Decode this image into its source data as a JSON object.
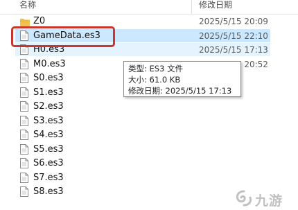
{
  "columns": {
    "name": "名称",
    "date": "修改日期"
  },
  "files": [
    {
      "name": "Z0",
      "date": "2025/5/15 20:09",
      "type": "folder",
      "state": ""
    },
    {
      "name": "GameData.es3",
      "date": "2025/5/15 22:10",
      "type": "file",
      "state": "selected"
    },
    {
      "name": "H0.es3",
      "date": "2025/5/15 17:13",
      "type": "file",
      "state": "hovered"
    },
    {
      "name": "M0.es3",
      "date": "2025/5/15 20:52",
      "type": "file",
      "state": ""
    },
    {
      "name": "S0.es3",
      "date": "",
      "type": "file",
      "state": ""
    },
    {
      "name": "S1.es3",
      "date": "",
      "type": "file",
      "state": ""
    },
    {
      "name": "S2.es3",
      "date": "",
      "type": "file",
      "state": ""
    },
    {
      "name": "S3.es3",
      "date": "",
      "type": "file",
      "state": ""
    },
    {
      "name": "S4.es3",
      "date": "",
      "type": "file",
      "state": ""
    },
    {
      "name": "S5.es3",
      "date": "",
      "type": "file",
      "state": ""
    },
    {
      "name": "S6.es3",
      "date": "",
      "type": "file",
      "state": ""
    },
    {
      "name": "S7.es3",
      "date": "",
      "type": "file",
      "state": ""
    },
    {
      "name": "S8.es3",
      "date": "",
      "type": "file",
      "state": ""
    }
  ],
  "tooltip": {
    "type_line": "类型: ES3 文件",
    "size_line": "大小: 61.0 KB",
    "modified_line": "修改日期: 2025/5/15 17:13"
  },
  "colors": {
    "selection": "#cce8ff",
    "highlight_border": "#c8372d",
    "folder": "#f3c14b"
  },
  "watermark": {
    "text": "九游",
    "icon": "swirl-logo-icon"
  }
}
